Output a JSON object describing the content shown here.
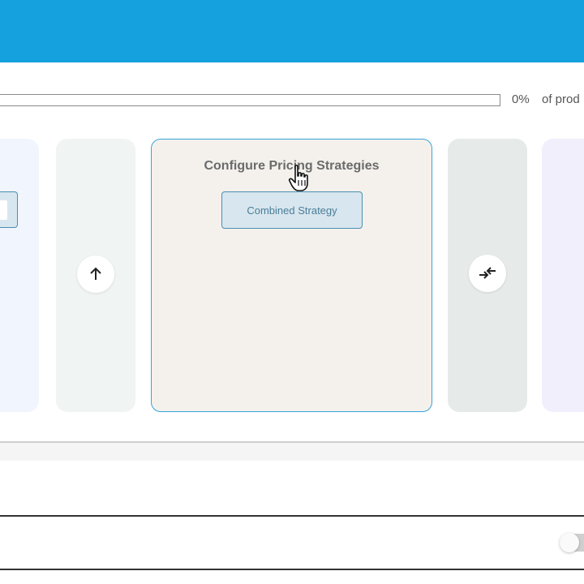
{
  "progress": {
    "percent_label": "0%",
    "suffix": "of prod",
    "value": 0
  },
  "cards": {
    "main": {
      "title": "Configure Pricing Strategies",
      "option_label": "Combined Strategy"
    },
    "up_icon": "arrow-up-icon",
    "swap_icon": "swap-arrows-icon"
  },
  "colors": {
    "accent": "#14a1dd",
    "selected_border": "#37a4d8",
    "option_bg": "#d8e6ef",
    "option_border": "#4a8fb0"
  }
}
